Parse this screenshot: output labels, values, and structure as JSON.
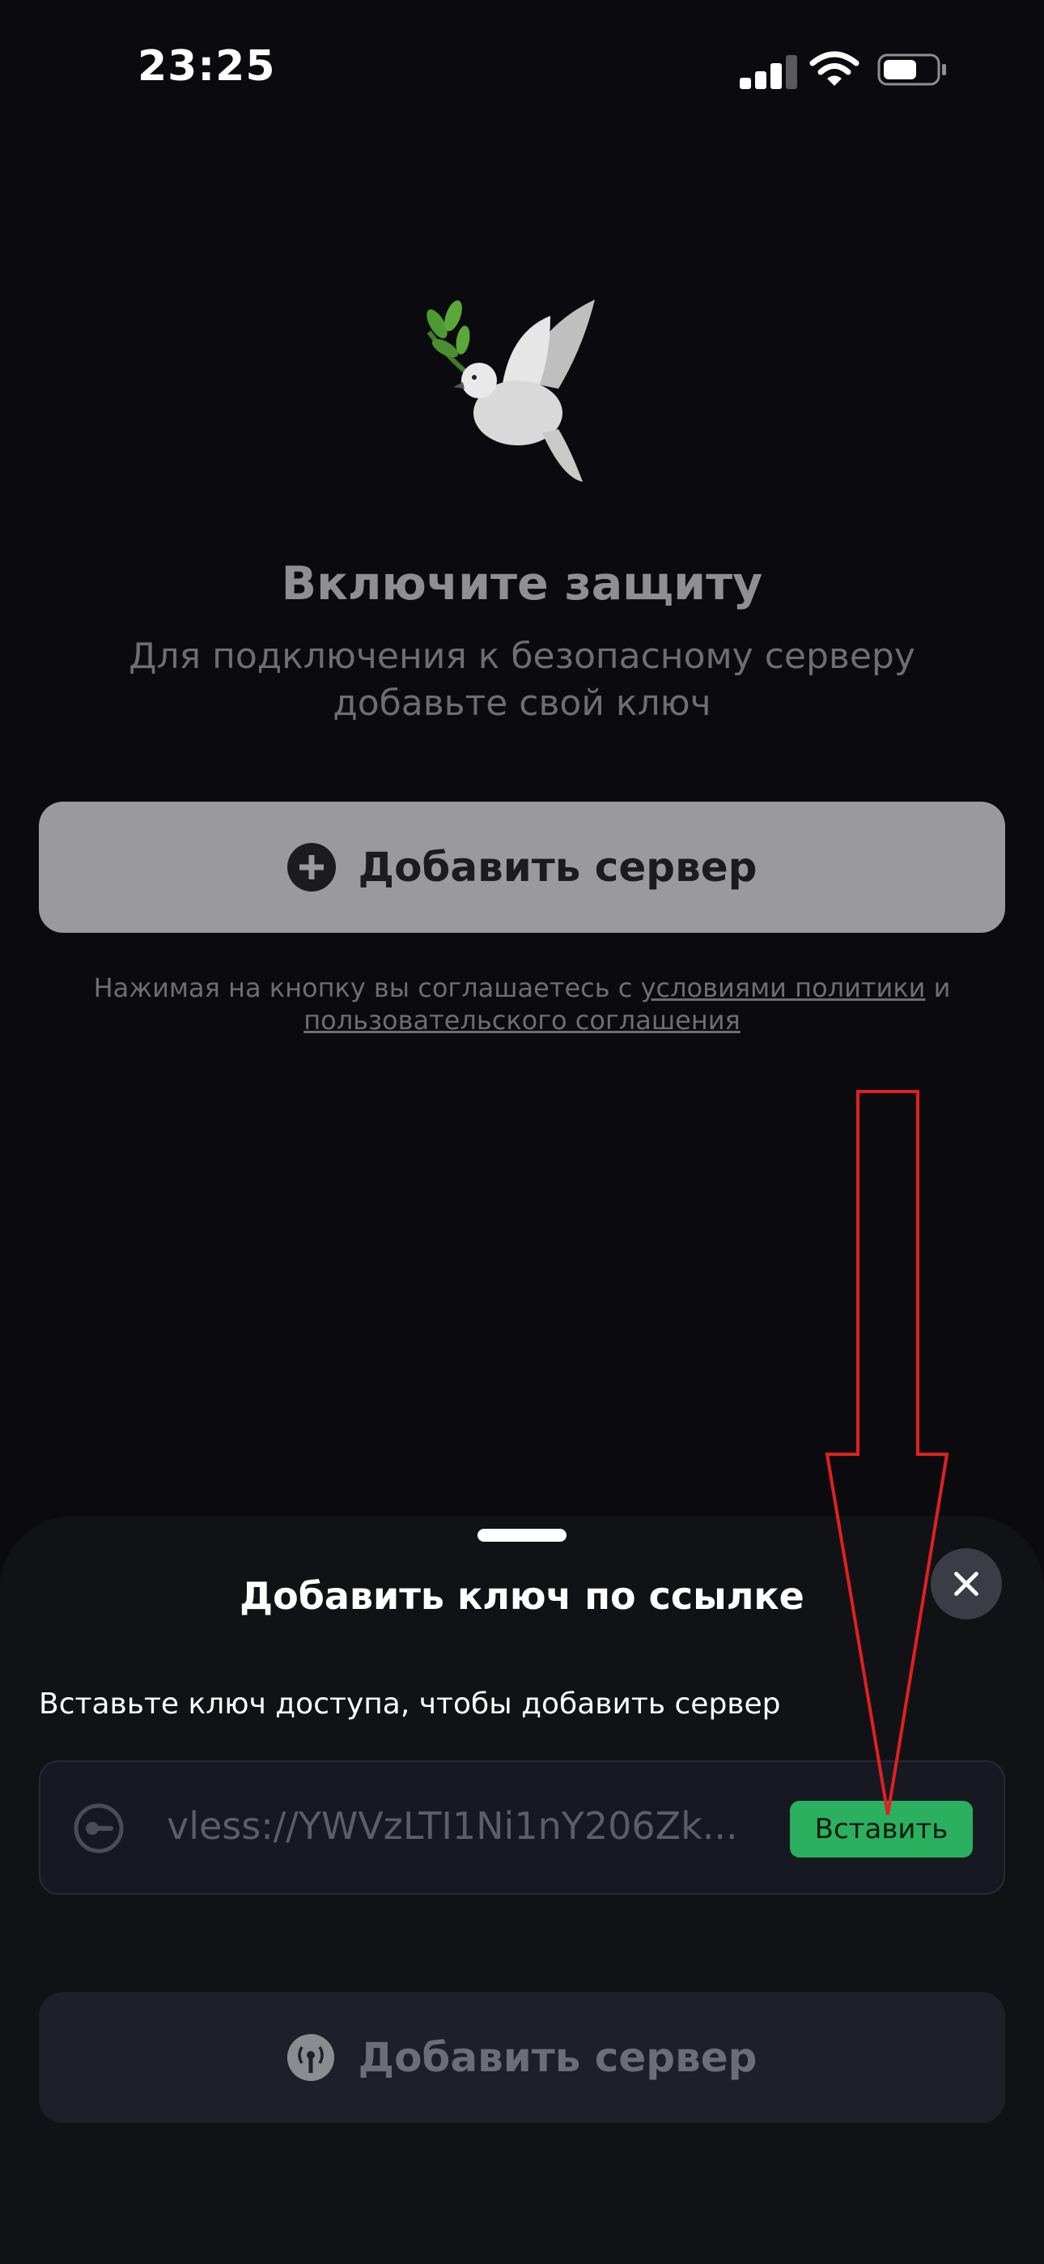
{
  "status_bar": {
    "time": "23:25"
  },
  "main": {
    "hero_icon": "dove-with-olive-branch",
    "title": "Включите защиту",
    "subtitle": "Для подключения к безопасному серверу добавьте свой ключ",
    "add_server_label": "Добавить сервер",
    "terms": {
      "prefix": "Нажимая на кнопку вы соглашаетесь с",
      "link1": "условиями политики",
      "joiner": "и",
      "link2": "пользовательского соглашения"
    }
  },
  "sheet": {
    "title": "Добавить ключ по ссылке",
    "instruction": "Вставьте ключ доступа, чтобы добавить сервер",
    "key_value": "vless://YWVzLTI1Ni1nY206Zk...",
    "paste_label": "Вставить",
    "add_server_label": "Добавить сервер"
  },
  "colors": {
    "background": "#0b0b0f",
    "accent_green": "#2bb05f",
    "annotation_red": "#e02020"
  }
}
